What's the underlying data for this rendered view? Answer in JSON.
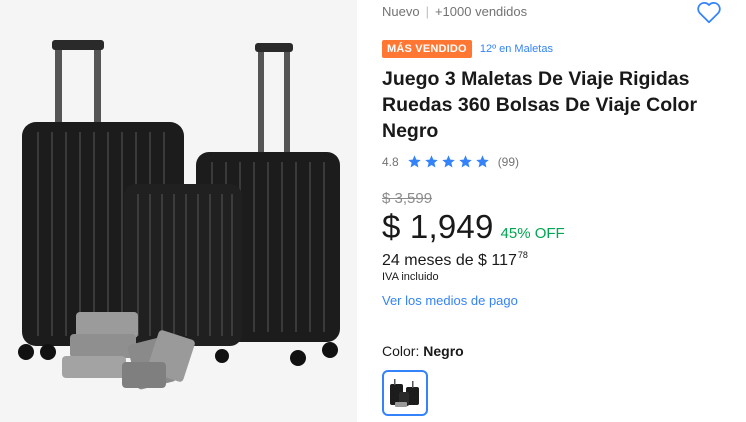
{
  "gallery": {
    "image_alt": "Juego 3 Maletas De Viaje Rigidas Ruedas 360 Bolsas De Viaje Color Negro",
    "background": "#f5f5f5"
  },
  "header": {
    "condition": "Nuevo",
    "separator": "|",
    "sold": "+1000 vendidos",
    "favorite_icon": "heart-outline-icon"
  },
  "badge": {
    "label": "MÁS VENDIDO",
    "ranking": "12º en Maletas",
    "color": "#ff7733"
  },
  "product": {
    "title": "Juego 3 Maletas De Viaje Rigidas Ruedas 360 Bolsas De Viaje Color Negro"
  },
  "rating": {
    "score": "4.8",
    "stars": 5,
    "star_fill": 0.96,
    "reviews": "(99)",
    "star_color": "#3483fa"
  },
  "pricing": {
    "original": "$ 3,599",
    "current": "$ 1,949",
    "discount": "45% OFF",
    "installments_prefix": "24 meses de $ 117",
    "installments_cents": "78",
    "tax_note": "IVA incluido",
    "payment_link": "Ver los medios de pago",
    "discount_color": "#00a650",
    "link_color": "#3483fa"
  },
  "variation": {
    "label": "Color:",
    "selected": "Negro"
  }
}
